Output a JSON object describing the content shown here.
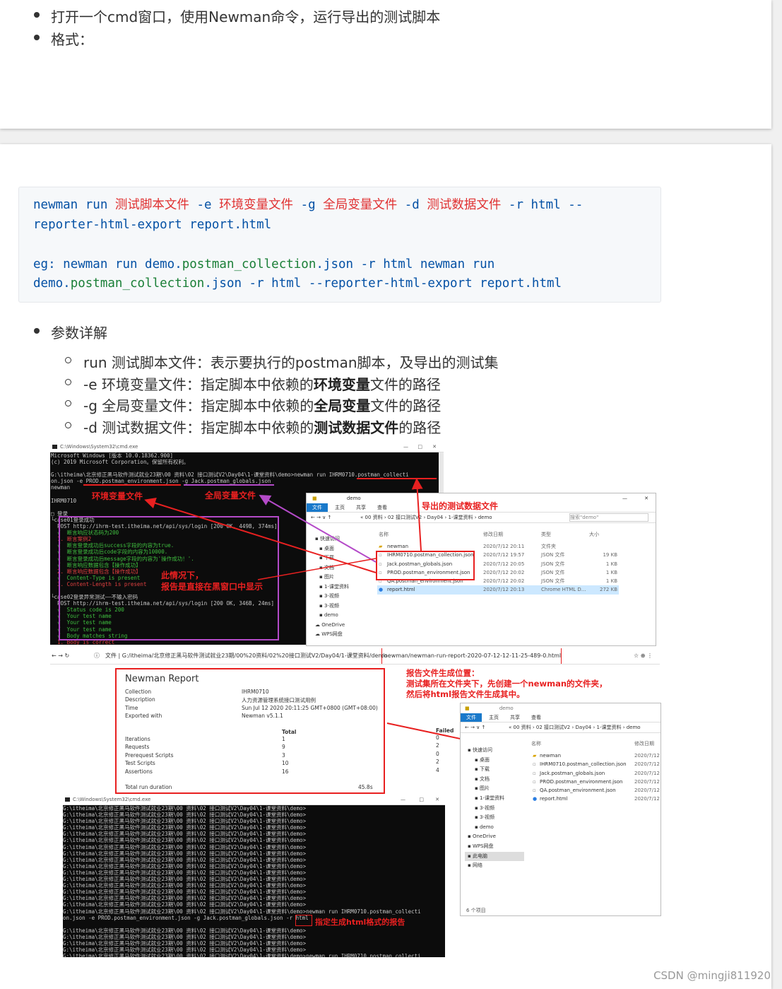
{
  "top_bullets": [
    "打开一个cmd窗口，使用Newman命令，运行导出的测试脚本",
    "格式："
  ],
  "code": {
    "line1": {
      "a": "newman run ",
      "b": "测试脚本文件",
      "c": " -e ",
      "d": "环境变量文件",
      "e": " -g ",
      "f": "全局变量文件",
      "g": " -d ",
      "h": "测试数据文件",
      "i": " -r html --"
    },
    "line2": "reporter-html-export report.html",
    "line3": {
      "a": "eg: ",
      "b": "newman run demo.",
      "c": "postman_collection",
      "d": ".json -r html newman run"
    },
    "line4": {
      "a": "demo.",
      "b": "postman_collection",
      "c": ".json -r html --reporter-html-export report.html"
    }
  },
  "params": {
    "heading": "参数详解",
    "items": [
      {
        "pre": "run 测试脚本文件：表示要执行的postman脚本，及导出的测试集",
        "bold": "",
        "post": ""
      },
      {
        "pre": "-e 环境变量文件：指定脚本中依赖的",
        "bold": "环境变量",
        "post": "文件的路径"
      },
      {
        "pre": "-g 全局变量文件：指定脚本中依赖的",
        "bold": "全局变量",
        "post": "文件的路径"
      },
      {
        "pre": "-d 测试数据文件：指定脚本中依赖的",
        "bold": "测试数据文件",
        "post": "的路径"
      }
    ]
  },
  "shot1": {
    "cmd_title": "C:\\Windows\\System32\\cmd.exe",
    "cmd_lines": [
      "Microsoft Windows [版本 10.0.18362.900]",
      "(c) 2019 Microsoft Corporation。保留所有权利。",
      "",
      "G:\\itheima\\北京修正黑马软件测试就业23期\\00 资料\\02 接口测试V2\\Day04\\1-课堂资料\\demo>newman run IHRM0710.postman_collecti",
      "on.json -e PROD.postman_environment.json -g Jack.postman_globals.json",
      "newman",
      "",
      "IHRM0710",
      "",
      "□ 登录",
      "└case01登录成功",
      "  POST http://ihrm-test.itheima.net/api/sys/login [200 OK, 449B, 374ms]",
      "  √  断言响应状态码为200",
      "  1. 断言案例2",
      "  √  断言登录成功后success字段的内容为true.",
      "  √  断言登录成功后code字段的内容为10000.",
      "  √  断言登录成功后message字段的内容为'操作成功！'.",
      "  √  断言响应数据包含【操作成功】",
      "  2. 断言响应数据包含【操作成功】",
      "  √  Content-Type is present",
      "  3. Content-Length is present",
      "",
      "└case02登录异常测试——不输入密码",
      "  POST http://ihrm-test.itheima.net/api/sys/login [200 OK, 346B, 24ms]",
      "  √  Status code is 200",
      "  √  Your test name",
      "  √  Your test name",
      "  √  Your test name",
      "  √  Body matches string",
      "  1. Body is correct"
    ],
    "labels": {
      "env": "环境变量文件",
      "global": "全局变量文件",
      "exported": "导出的测试数据文件",
      "note1": "此情况下，",
      "note2": "报告是直接在黑窗口中显示"
    },
    "explorer": {
      "title": "demo",
      "ribbon": [
        "文件",
        "主页",
        "共享",
        "查看"
      ],
      "path": "« 00 资料 › 02 接口测试V2 › Day04 › 1-课堂资料 › demo",
      "search": "搜索\"demo\"",
      "headers": [
        "名称",
        "修改日期",
        "类型",
        "大小"
      ],
      "nav": [
        "快速访问",
        "桌面",
        "下载",
        "文档",
        "图片",
        "1-课堂资料",
        "3-视频",
        "3-视频",
        "demo",
        "OneDrive",
        "WPS网盘"
      ],
      "files": [
        {
          "name": "newman",
          "date": "2020/7/12 20:11",
          "type": "文件夹",
          "size": ""
        },
        {
          "name": "IHRM0710.postman_collection.json",
          "date": "2020/7/12 19:57",
          "type": "JSON 文件",
          "size": "19 KB"
        },
        {
          "name": "Jack.postman_globals.json",
          "date": "2020/7/12 20:05",
          "type": "JSON 文件",
          "size": "1 KB"
        },
        {
          "name": "PROD.postman_environment.json",
          "date": "2020/7/12 20:02",
          "type": "JSON 文件",
          "size": "1 KB"
        },
        {
          "name": "QA.postman_environment.json",
          "date": "2020/7/12 20:02",
          "type": "JSON 文件",
          "size": "1 KB"
        },
        {
          "name": "report.html",
          "date": "2020/7/12 20:13",
          "type": "Chrome HTML D...",
          "size": "272 KB"
        }
      ]
    }
  },
  "shot2": {
    "url_prefix": "文件 | G:/itheima/北京修正黑马软件测试就业23期/00%20资料/02%20接口测试V2/Day04/1-课堂资料/demo",
    "url_highlight": "/newman/newman-run-report-2020-07-12-12-11-25-489-0.html",
    "report": {
      "title": "Newman Report",
      "rows": [
        {
          "k": "Collection",
          "v": "IHRM0710"
        },
        {
          "k": "Description",
          "v": "人力资源管理系统接口测试用例"
        },
        {
          "k": "Time",
          "v": "Sun Jul 12 2020 20:11:25 GMT+0800 (GMT+08:00)"
        },
        {
          "k": "Exported with",
          "v": "Newman v5.1.1"
        }
      ],
      "total_label": "Total",
      "failed_label": "Failed",
      "stats": [
        {
          "k": "Iterations",
          "total": "1",
          "failed": "0"
        },
        {
          "k": "Requests",
          "total": "9",
          "failed": "2"
        },
        {
          "k": "Prerequest Scripts",
          "total": "3",
          "failed": "0"
        },
        {
          "k": "Test Scripts",
          "total": "10",
          "failed": "2"
        },
        {
          "k": "Assertions",
          "total": "16",
          "failed": "4"
        }
      ],
      "duration_label": "Total run duration",
      "duration_value": "45.8s"
    },
    "note_lines": [
      "报告文件生成位置：",
      "测试集所在文件夹下，先创建一个newman的文件夹，",
      "然后将html报告文件生成其中。"
    ],
    "explorer2": {
      "title": "demo",
      "ribbon": [
        "文件",
        "主页",
        "共享",
        "查看"
      ],
      "path": "« 00 资料 › 02 接口测试V2 › Day04 › 1-课堂资料 › demo",
      "headers": [
        "名称",
        "修改日期"
      ],
      "nav": [
        "快速访问",
        "桌面",
        "下载",
        "文档",
        "图片",
        "1-课堂资料",
        "3-视频",
        "3-视频",
        "demo",
        "OneDrive",
        "WPS网盘",
        "此电脑",
        "网络"
      ],
      "files": [
        {
          "name": "newman",
          "date": "2020/7/12"
        },
        {
          "name": "IHRM0710.postman_collection.json",
          "date": "2020/7/12"
        },
        {
          "name": "Jack.postman_globals.json",
          "date": "2020/7/12"
        },
        {
          "name": "PROD.postman_environment.json",
          "date": "2020/7/12"
        },
        {
          "name": "QA.postman_environment.json",
          "date": "2020/7/12"
        },
        {
          "name": "report.html",
          "date": "2020/7/12"
        }
      ],
      "count": "6 个项目"
    },
    "cmd2": {
      "title": "C:\\Windows\\System32\\cmd.exe",
      "prompt": "G:\\itheima\\北京修正黑马软件测试就业23期\\00 资料\\02 接口测试V2\\Day04\\1-课堂资料\\demo>",
      "cmd_line1": "G:\\itheima\\北京修正黑马软件测试就业23期\\00 资料\\02 接口测试V2\\Day04\\1-课堂资料\\demo>newman run IHRM0710.postman_collecti",
      "cmd_line2": "on.json -e PROD.postman_environment.json -g Jack.postman_globals.json -r html",
      "last_line": "G:\\itheima\\北京修正黑马软件测试就业23期\\00 资料\\02 接口测试V2\\Day04\\1-课堂资料\\demo>newman run IHRM0710.postman_collecti",
      "html_label": "指定生成html格式的报告"
    }
  },
  "watermark": "CSDN @mingji811920"
}
